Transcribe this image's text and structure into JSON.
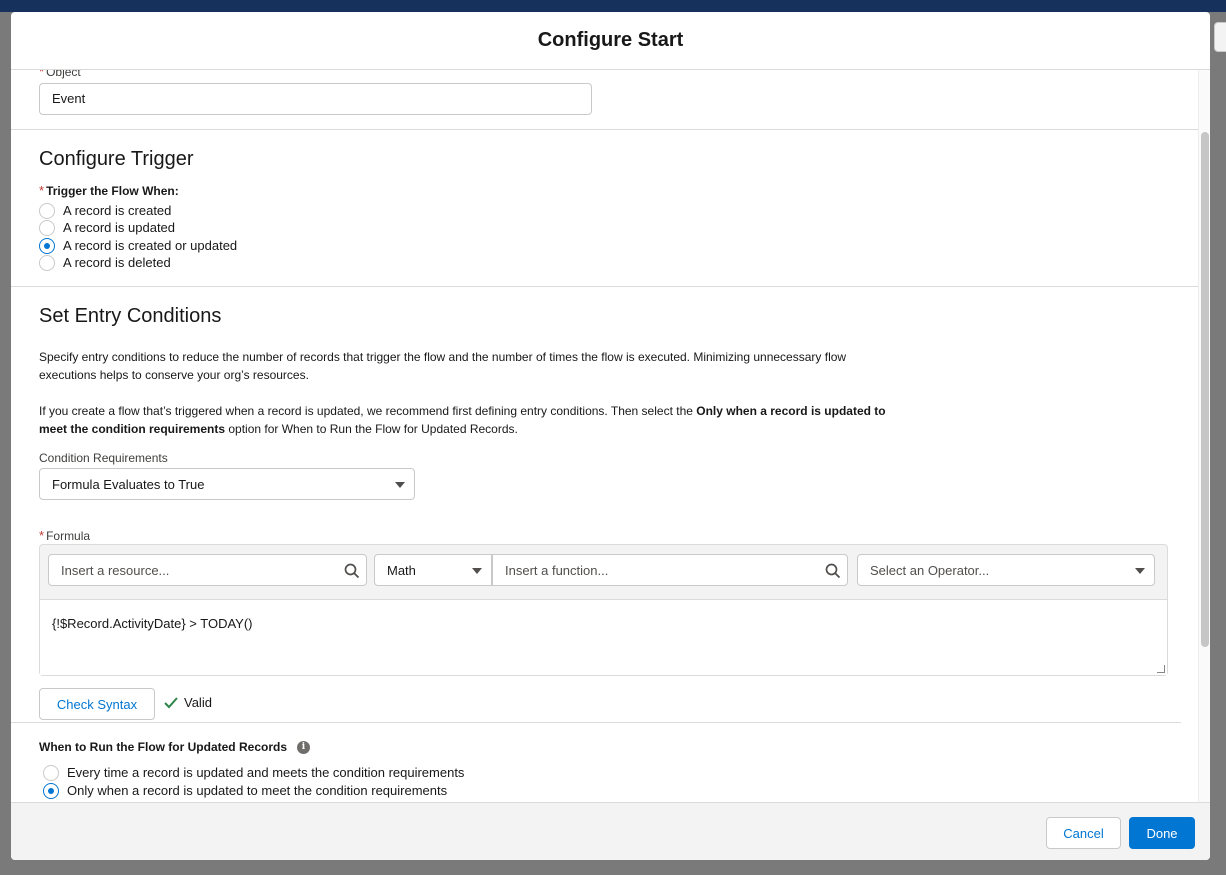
{
  "modal": {
    "title": "Configure Start"
  },
  "object_field": {
    "label": "Object",
    "value": "Event"
  },
  "configure_trigger": {
    "title": "Configure Trigger",
    "label": "Trigger the Flow When:",
    "options": [
      {
        "label": "A record is created",
        "selected": false
      },
      {
        "label": "A record is updated",
        "selected": false
      },
      {
        "label": "A record is created or updated",
        "selected": true
      },
      {
        "label": "A record is deleted",
        "selected": false
      }
    ]
  },
  "entry_conditions": {
    "title": "Set Entry Conditions",
    "description_1": "Specify entry conditions to reduce the number of records that trigger the flow and the number of times the flow is executed. Minimizing unnecessary flow executions helps to conserve your org’s resources.",
    "description_2_pre": "If you create a flow that’s triggered when a record is updated, we recommend first defining entry conditions. Then select the ",
    "description_2_bold": "Only when a record is updated to meet the condition requirements",
    "description_2_post": " option for When to Run the Flow for Updated Records.",
    "condition_requirements_label": "Condition Requirements",
    "condition_requirements_value": "Formula Evaluates to True"
  },
  "formula": {
    "label": "Formula",
    "resource_placeholder": "Insert a resource...",
    "function_category": "Math",
    "function_placeholder": "Insert a function...",
    "operator_placeholder": "Select an Operator...",
    "expression": "{!$Record.ActivityDate} > TODAY()",
    "check_syntax_label": "Check Syntax",
    "status": "Valid"
  },
  "run_when_updated": {
    "label": "When to Run the Flow for Updated Records",
    "options": [
      {
        "label": "Every time a record is updated and meets the condition requirements",
        "selected": false
      },
      {
        "label": "Only when a record is updated to meet the condition requirements",
        "selected": true
      }
    ]
  },
  "footer": {
    "cancel_label": "Cancel",
    "done_label": "Done"
  },
  "colors": {
    "brand": "#0176d3",
    "header": "#16325c",
    "required": "#c23934",
    "valid": "#2e844a"
  }
}
